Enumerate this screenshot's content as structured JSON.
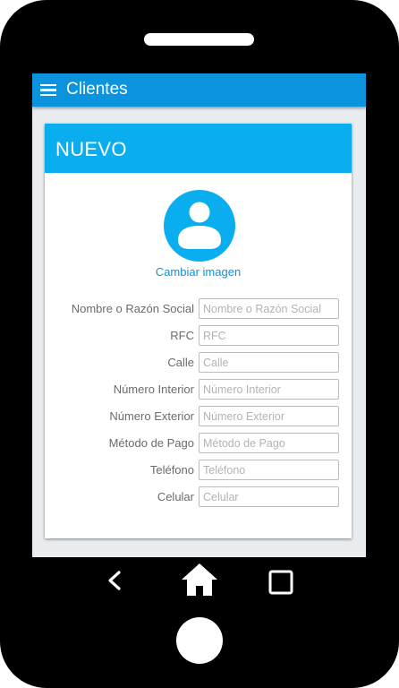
{
  "app": {
    "title": "Clientes"
  },
  "card": {
    "title": "NUEVO",
    "change_image_label": "Cambiar imagen"
  },
  "form": {
    "fields": [
      {
        "label": "Nombre o Razón Social",
        "placeholder": "Nombre o Razón Social"
      },
      {
        "label": "RFC",
        "placeholder": "RFC"
      },
      {
        "label": "Calle",
        "placeholder": "Calle"
      },
      {
        "label": "Número Interior",
        "placeholder": "Número Interior"
      },
      {
        "label": "Número Exterior",
        "placeholder": "Número Exterior"
      },
      {
        "label": "Método de Pago",
        "placeholder": "Método de Pago"
      },
      {
        "label": "Teléfono",
        "placeholder": "Teléfono"
      },
      {
        "label": "Celular",
        "placeholder": "Celular"
      }
    ]
  },
  "icons": {
    "menu": "hamburger-menu-icon",
    "avatar": "user-avatar-icon",
    "back": "chevron-left-icon",
    "home": "home-icon",
    "recent": "square-recent-apps-icon"
  },
  "colors": {
    "appbar": "#0b93de",
    "card_header": "#0aaeef",
    "link": "#0b93de",
    "avatar": "#0aaeef",
    "phone_frame": "#000000"
  }
}
